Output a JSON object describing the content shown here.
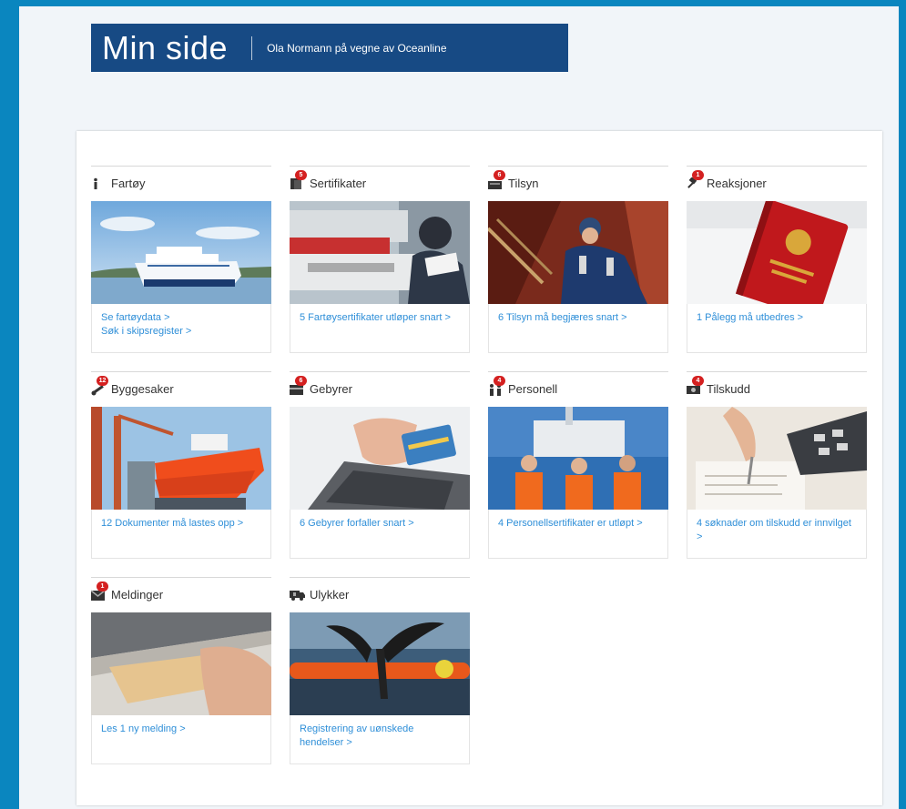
{
  "header": {
    "title": "Min side",
    "subtitle": "Ola Normann på vegne av Oceanline"
  },
  "cards": [
    {
      "title": "Fartøy",
      "icon": "info-icon",
      "badge": "",
      "links": [
        "Se fartøydata >",
        "Søk i skipsregister >"
      ]
    },
    {
      "title": "Sertifikater",
      "icon": "certificate-icon",
      "badge": "5",
      "links": [
        "5 Fartøysertifikater utløper snart >"
      ]
    },
    {
      "title": "Tilsyn",
      "icon": "inspection-icon",
      "badge": "6",
      "links": [
        "6 Tilsyn må begjæres snart >"
      ]
    },
    {
      "title": "Reaksjoner",
      "icon": "gavel-icon",
      "badge": "1",
      "links": [
        "1 Pålegg må utbedres >"
      ]
    },
    {
      "title": "Byggesaker",
      "icon": "wrench-icon",
      "badge": "12",
      "links": [
        "12 Dokumenter må lastes opp >"
      ]
    },
    {
      "title": "Gebyrer",
      "icon": "card-icon",
      "badge": "6",
      "links": [
        "6 Gebyrer forfaller snart >"
      ]
    },
    {
      "title": "Personell",
      "icon": "people-icon",
      "badge": "4",
      "links": [
        "4 Personellsertifikater er utløpt >"
      ]
    },
    {
      "title": "Tilskudd",
      "icon": "money-icon",
      "badge": "4",
      "links": [
        "4 søknader om tilskudd er innvilget >"
      ]
    },
    {
      "title": "Meldinger",
      "icon": "envelope-icon",
      "badge": "1",
      "links": [
        "Les 1 ny melding >"
      ]
    },
    {
      "title": "Ulykker",
      "icon": "ambulance-icon",
      "badge": "",
      "links": [
        "Registrering av uønskede hendelser >"
      ]
    }
  ],
  "colors": {
    "header_bg": "#174a84",
    "link": "#2f8fd8",
    "badge": "#d42020",
    "frame": "#0a86bf"
  }
}
